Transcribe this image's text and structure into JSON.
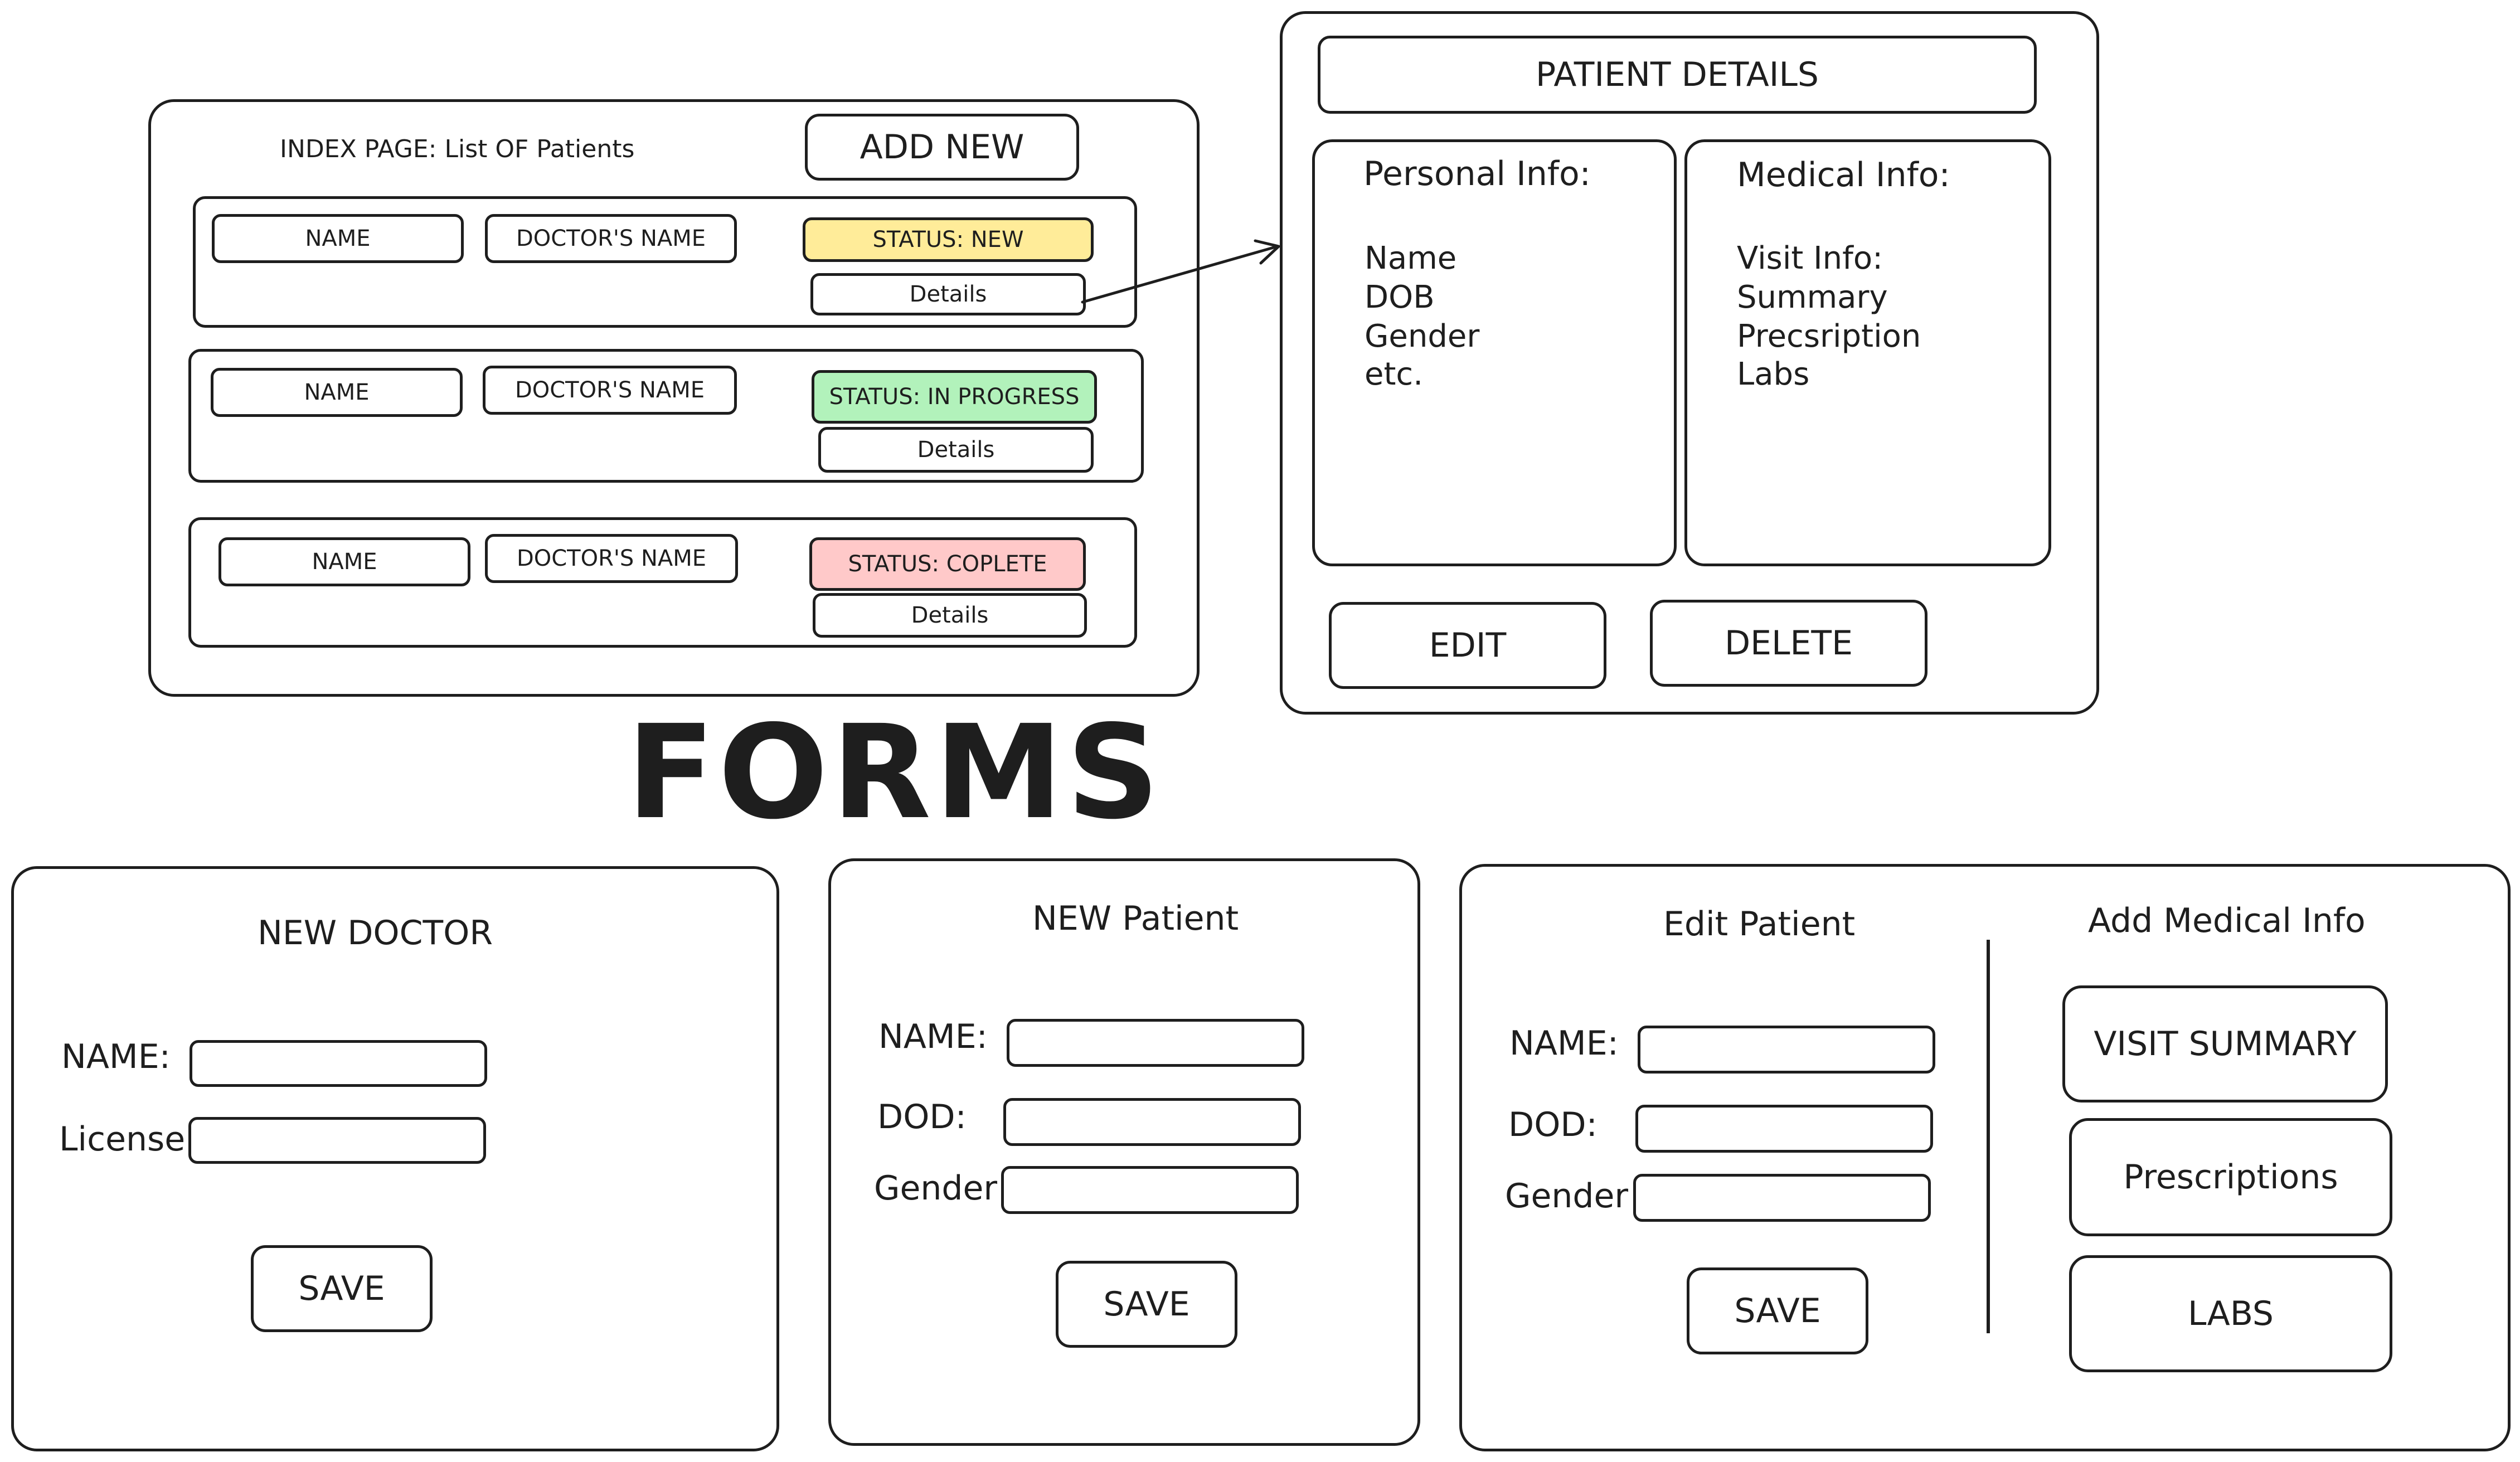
{
  "index": {
    "title": "INDEX PAGE: List OF Patients",
    "add_new": "ADD NEW",
    "rows": [
      {
        "name": "NAME",
        "doctor": "DOCTOR'S NAME",
        "status": "STATUS: NEW",
        "details": "Details",
        "status_color": "#ffec99"
      },
      {
        "name": "NAME",
        "doctor": "DOCTOR'S NAME",
        "status": "STATUS: IN PROGRESS",
        "details": "Details",
        "status_color": "#b2f2bb"
      },
      {
        "name": "NAME",
        "doctor": "DOCTOR'S NAME",
        "status": "STATUS: COPLETE",
        "details": "Details",
        "status_color": "#ffc9c9"
      }
    ]
  },
  "patient_details": {
    "title": "PATIENT DETAILS",
    "personal_heading": "Personal Info:",
    "personal_items": [
      "Name",
      "DOB",
      "Gender",
      "etc."
    ],
    "medical_heading": "Medical Info:",
    "medical_items": [
      "Visit Info:",
      "Summary",
      "Precsription",
      "Labs"
    ],
    "edit": "EDIT",
    "delete": "DELETE"
  },
  "forms_heading": "FORMS",
  "new_doctor": {
    "title": "NEW DOCTOR",
    "name_label": "NAME:",
    "license_label": "License:",
    "save": "SAVE"
  },
  "new_patient": {
    "title": "NEW Patient",
    "name_label": "NAME:",
    "dod_label": "DOD:",
    "gender_label": "Gender",
    "save": "SAVE"
  },
  "edit_patient": {
    "title": "Edit Patient",
    "name_label": "NAME:",
    "dod_label": "DOD:",
    "gender_label": "Gender",
    "save": "SAVE"
  },
  "add_medical": {
    "title": "Add Medical Info",
    "visit_summary": "VISIT SUMMARY",
    "prescriptions": "Prescriptions",
    "labs": "LABS"
  }
}
